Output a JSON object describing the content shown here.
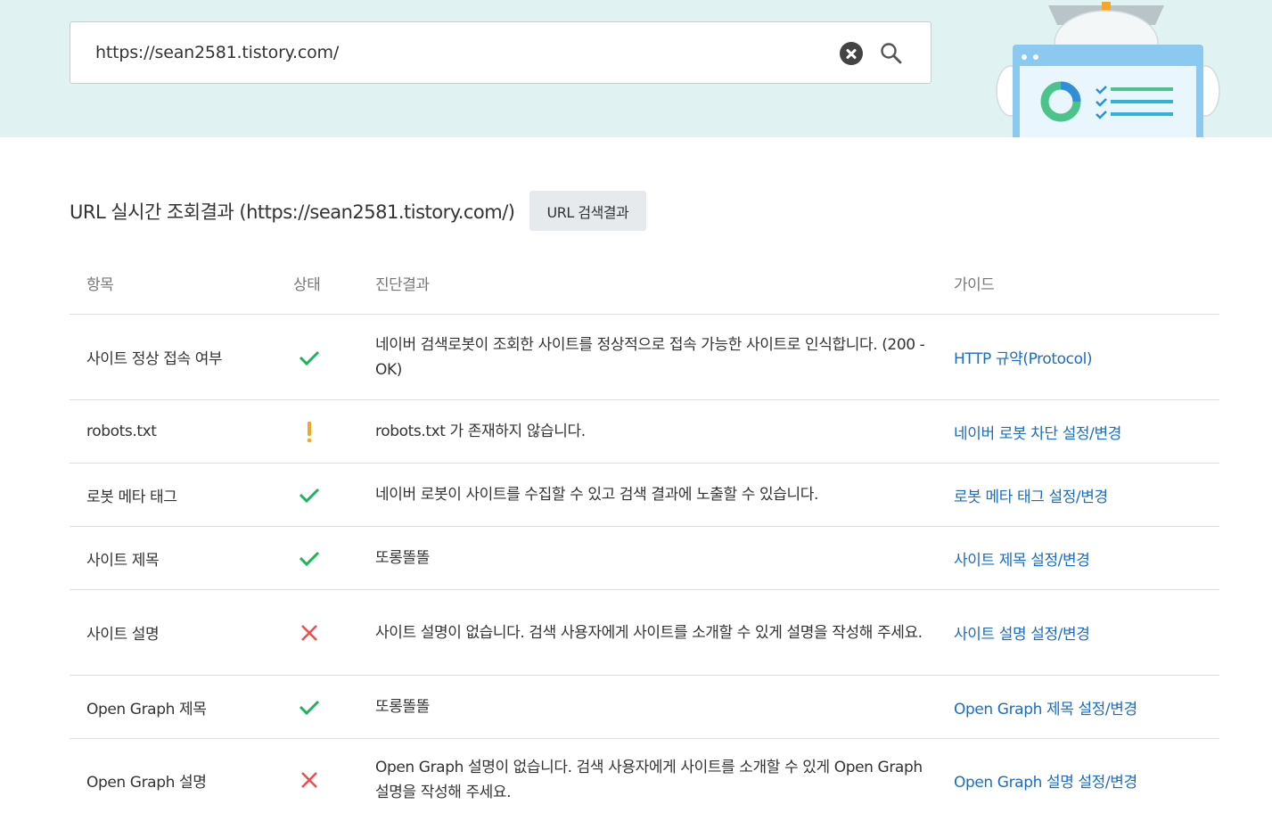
{
  "search": {
    "value": "https://sean2581.tistory.com/"
  },
  "result": {
    "title": "URL 실시간 조회결과 (https://sean2581.tistory.com/)",
    "button_label": "URL 검색결과"
  },
  "table": {
    "headers": [
      "항목",
      "상태",
      "진단결과",
      "가이드"
    ],
    "rows": [
      {
        "item": "사이트 정상 접속 여부",
        "status": "ok",
        "result": "네이버 검색로봇이 조회한 사이트를 정상적으로 접속 가능한 사이트로 인식합니다. (200 - OK)",
        "guide": "HTTP 규약(Protocol)"
      },
      {
        "item": "robots.txt",
        "status": "warning",
        "result": "robots.txt 가 존재하지 않습니다.",
        "guide": "네이버 로봇 차단 설정/변경"
      },
      {
        "item": "로봇 메타 태그",
        "status": "ok",
        "result": "네이버 로봇이 사이트를 수집할 수 있고 검색 결과에 노출할 수 있습니다.",
        "guide": "로봇 메타 태그 설정/변경"
      },
      {
        "item": "사이트 제목",
        "status": "ok",
        "result": "또롱똘똘",
        "guide": "사이트 제목 설정/변경"
      },
      {
        "item": "사이트 설명",
        "status": "error",
        "result": "사이트 설명이 없습니다. 검색 사용자에게 사이트를 소개할 수 있게 설명을 작성해 주세요.",
        "guide": "사이트 설명 설정/변경"
      },
      {
        "item": "Open Graph 제목",
        "status": "ok",
        "result": "또롱똘똘",
        "guide": "Open Graph 제목 설정/변경"
      },
      {
        "item": "Open Graph 설명",
        "status": "error",
        "result": "Open Graph 설명이 없습니다. 검색 사용자에게 사이트를 소개할 수 있게 Open Graph 설명을 작성해 주세요.",
        "guide": "Open Graph 설명 설정/변경"
      }
    ]
  },
  "colors": {
    "hero_bg": "#e0f3f2",
    "ok": "#1bb55c",
    "warning": "#f5a623",
    "error": "#f04e4e",
    "link": "#1a6dc4"
  }
}
